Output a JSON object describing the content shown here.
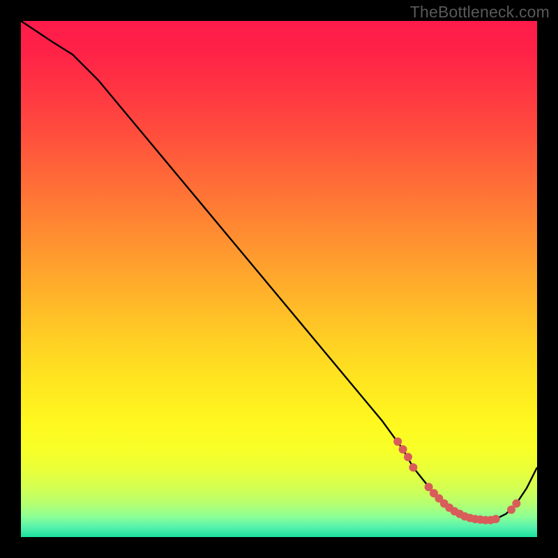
{
  "watermark": "TheBottleneck.com",
  "chart_data": {
    "type": "line",
    "title": "",
    "xlabel": "",
    "ylabel": "",
    "xlim": [
      0,
      100
    ],
    "ylim": [
      0,
      100
    ],
    "series": [
      {
        "name": "curve",
        "x": [
          0,
          3,
          6,
          10,
          15,
          20,
          25,
          30,
          35,
          40,
          45,
          50,
          55,
          60,
          65,
          70,
          74,
          76,
          78,
          80,
          82,
          84,
          86,
          88,
          90,
          92,
          94,
          96,
          98,
          100
        ],
        "y": [
          100,
          98,
          96,
          93.5,
          88.5,
          82.5,
          76.5,
          70.5,
          64.5,
          58.5,
          52.5,
          46.5,
          40.5,
          34.5,
          28.5,
          22.5,
          17.0,
          13.5,
          11.0,
          8.5,
          6.5,
          5.0,
          4.0,
          3.5,
          3.3,
          3.5,
          4.5,
          6.5,
          9.5,
          13.5
        ]
      }
    ],
    "dots": {
      "name": "marked-points",
      "x": [
        73,
        74,
        75,
        76,
        79,
        80,
        81,
        82,
        83,
        84,
        85,
        86,
        87,
        88,
        89,
        90,
        91,
        92,
        95,
        96
      ],
      "y": [
        18.5,
        17.0,
        15.5,
        13.5,
        9.7,
        8.5,
        7.5,
        6.5,
        5.7,
        5.0,
        4.5,
        4.0,
        3.7,
        3.5,
        3.4,
        3.3,
        3.3,
        3.5,
        5.3,
        6.5
      ]
    },
    "gradient_stops": [
      {
        "pos": 0.0,
        "color": "#ff1b4b"
      },
      {
        "pos": 0.06,
        "color": "#ff2247"
      },
      {
        "pos": 0.14,
        "color": "#ff3742"
      },
      {
        "pos": 0.22,
        "color": "#ff4e3d"
      },
      {
        "pos": 0.3,
        "color": "#ff6838"
      },
      {
        "pos": 0.38,
        "color": "#ff8233"
      },
      {
        "pos": 0.46,
        "color": "#ff9c2e"
      },
      {
        "pos": 0.54,
        "color": "#ffb629"
      },
      {
        "pos": 0.62,
        "color": "#ffd024"
      },
      {
        "pos": 0.7,
        "color": "#ffe620"
      },
      {
        "pos": 0.78,
        "color": "#fff81f"
      },
      {
        "pos": 0.83,
        "color": "#f8ff28"
      },
      {
        "pos": 0.87,
        "color": "#e9ff3a"
      },
      {
        "pos": 0.905,
        "color": "#d3ff52"
      },
      {
        "pos": 0.935,
        "color": "#b6ff70"
      },
      {
        "pos": 0.96,
        "color": "#8dff94"
      },
      {
        "pos": 0.98,
        "color": "#58f3ad"
      },
      {
        "pos": 1.0,
        "color": "#1be09d"
      }
    ],
    "legend": null,
    "grid": false
  }
}
